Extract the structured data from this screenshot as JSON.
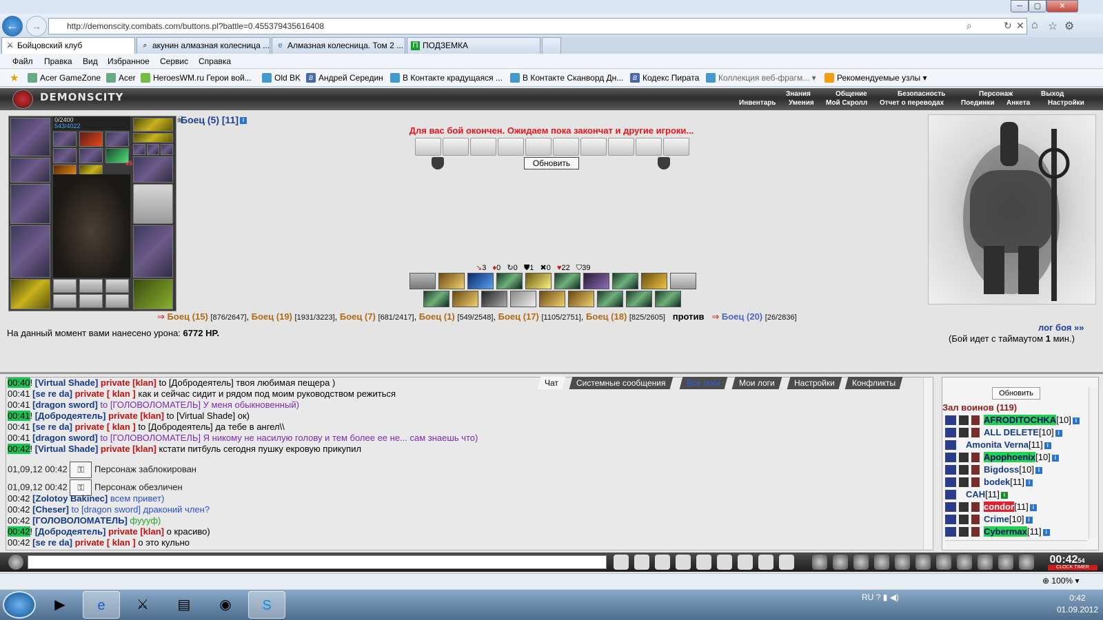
{
  "window": {
    "controls": [
      "─",
      "▢",
      "✕"
    ]
  },
  "browser": {
    "url": "http://demonscity.combats.com/buttons.pl?battle=0.455379435616408",
    "tabs": [
      {
        "label": "Бойцовский клуб",
        "active": true
      },
      {
        "label": "акунин алмазная колесница ...",
        "active": false
      },
      {
        "label": "Алмазная колесница. Том 2 ...",
        "active": false
      },
      {
        "label": "ПОДЗЕМКА",
        "active": false
      }
    ],
    "menu": [
      "Файл",
      "Правка",
      "Вид",
      "Избранное",
      "Сервис",
      "Справка"
    ],
    "favorites": [
      "Acer GameZone",
      "Acer",
      "HeroesWM.ru Герои вой...",
      "Old BK",
      "Андрей Середин",
      "В Контакте  крадущаяся ...",
      "В Контакте  Сканворд Дн...",
      "Кодекс Пирата",
      "Коллекция веб-фрагм...",
      "Рекомендуемые узлы"
    ],
    "zoom": "100%"
  },
  "game": {
    "logo": "DEMONSCITY",
    "nav_top": [
      "Знания",
      "Общение",
      "Безопасность",
      "Персонаж",
      "Выход"
    ],
    "nav_bottom": [
      "Инвентарь",
      "Умения",
      "Мой Скролл",
      "Отчет о переводах",
      "Поединки",
      "Анкета",
      "Настройки"
    ],
    "hp": "0/2400",
    "mana": "543/4022",
    "stack_x5": "x5",
    "stack_x2": "x2",
    "self": "Боец (5) [11]",
    "notice": "Для вас бой окончен. Ожидаем пока закончат и другие игроки...",
    "refresh": "Обновить",
    "stats": [
      "3",
      "0",
      "0",
      "1",
      "0",
      "22",
      "39"
    ],
    "fighters_team1": [
      {
        "name": "Боец (15)",
        "hp": "[876/2647]"
      },
      {
        "name": "Боец (19)",
        "hp": "[1931/3223]"
      },
      {
        "name": "Боец (7)",
        "hp": "[681/2417]"
      },
      {
        "name": "Боец (1)",
        "hp": "[549/2548]"
      },
      {
        "name": "Боец (17)",
        "hp": "[1105/2751]"
      },
      {
        "name": "Боец (18)",
        "hp": "[825/2605]"
      }
    ],
    "vs": "против",
    "fighter_team2": {
      "name": "Боец (20)",
      "hp": "[26/2836]"
    },
    "damage_label": "На данный момент вами нанесено урона:",
    "damage_value": "6772 HP.",
    "log_link": "лог боя »»",
    "timeout_prefix": "(Бой идет с таймаутом",
    "timeout_value": "1",
    "timeout_suffix": "мин.)"
  },
  "chat": {
    "tabs": [
      "Чат",
      "Системные сообщения",
      "Все логи",
      "Мои логи",
      "Настройки",
      "Конфликты"
    ],
    "lines": [
      {
        "time": "00:40",
        "hl": true,
        "nick": "[Virtual Shade]",
        "priv": "private [klan]",
        "to": "to [Добродеятель]",
        "text": "твоя любимая пещера )"
      },
      {
        "time": "00:41",
        "hl": false,
        "nick": "[se re da]",
        "priv": "private [ klan ]",
        "to": "",
        "text": "как и сейчас сидит и рядом под моим руководством режиться"
      },
      {
        "time": "00:41",
        "hl": false,
        "nick": "[dragon sword]",
        "priv": "",
        "to": "to [ГОЛОВОЛОМАТЕЛЬ]",
        "text": "У меня обыкновенный)"
      },
      {
        "time": "00:41",
        "hl": true,
        "nick": "[Добродеятель]",
        "priv": "private [klan]",
        "to": "to [Virtual Shade]",
        "text": "ок)"
      },
      {
        "time": "00:41",
        "hl": false,
        "nick": "[se re da]",
        "priv": "private [ klan ]",
        "to": "to [Добродеятель]",
        "text": "да тебе в ангел\\\\"
      },
      {
        "time": "00:41",
        "hl": false,
        "nick": "[dragon sword]",
        "priv": "",
        "to": "to [ГОЛОВОЛОМАТЕЛЬ]",
        "text": "Я никому не насилую голову и тем более ее не... сам знаешь что)"
      },
      {
        "time": "00:42",
        "hl": true,
        "nick": "[Virtual Shade]",
        "priv": "private [klan]",
        "to": "",
        "text": "кстати питбуль сегодня пушку екровую прикупил"
      }
    ],
    "sys1_time": "01,09,12 00:42",
    "sys1_text": "Персонаж заблокирован",
    "sys2_time": "01,09,12 00:42",
    "sys2_text": "Персонаж обезличен",
    "lines2": [
      {
        "time": "00:42",
        "hl": false,
        "nick": "[Zolotoy Bakinec]",
        "priv": "",
        "to": "",
        "text": "всем привет)"
      },
      {
        "time": "00:42",
        "hl": false,
        "nick": "[Cheser]",
        "priv": "",
        "to": "to [dragon sword]",
        "text": "драконий член?"
      },
      {
        "time": "00:42",
        "hl": false,
        "nick": "[ГОЛОВОЛОМАТЕЛЬ]",
        "priv": "",
        "to": "",
        "text": "фуууф)"
      },
      {
        "time": "00:42",
        "hl": true,
        "nick": "[Добродеятель]",
        "priv": "private [klan]",
        "to": "",
        "text": "о красиво)"
      },
      {
        "time": "00:42",
        "hl": false,
        "nick": "[se re da]",
        "priv": "private [ klan ]",
        "to": "",
        "text": "о это кульно"
      }
    ]
  },
  "users": {
    "refresh": "Обновить",
    "title": "Зал воинов (119)",
    "list": [
      {
        "name": "AFRODITOCHKA",
        "lvl": "[10]",
        "hl": "g"
      },
      {
        "name": "ALL DELETE",
        "lvl": "[10]",
        "hl": ""
      },
      {
        "name": "Amonita Verna",
        "lvl": "[11]",
        "hl": ""
      },
      {
        "name": "Apophoenix",
        "lvl": "[10]",
        "hl": "g"
      },
      {
        "name": "Bigdoss",
        "lvl": "[10]",
        "hl": ""
      },
      {
        "name": "bodek",
        "lvl": "[11]",
        "hl": ""
      },
      {
        "name": "CAH",
        "lvl": "[11]",
        "hl": ""
      },
      {
        "name": "condor",
        "lvl": "[11]",
        "hl": "r"
      },
      {
        "name": "Crime",
        "lvl": "[10]",
        "hl": ""
      },
      {
        "name": "Cybermax",
        "lvl": "[11]",
        "hl": "g"
      }
    ]
  },
  "clock": {
    "time": "00:42",
    "sec": "54",
    "label": "CLOCK TIMER"
  },
  "taskbar": {
    "lang": "RU",
    "time": "0:42",
    "date": "01.09.2012"
  }
}
